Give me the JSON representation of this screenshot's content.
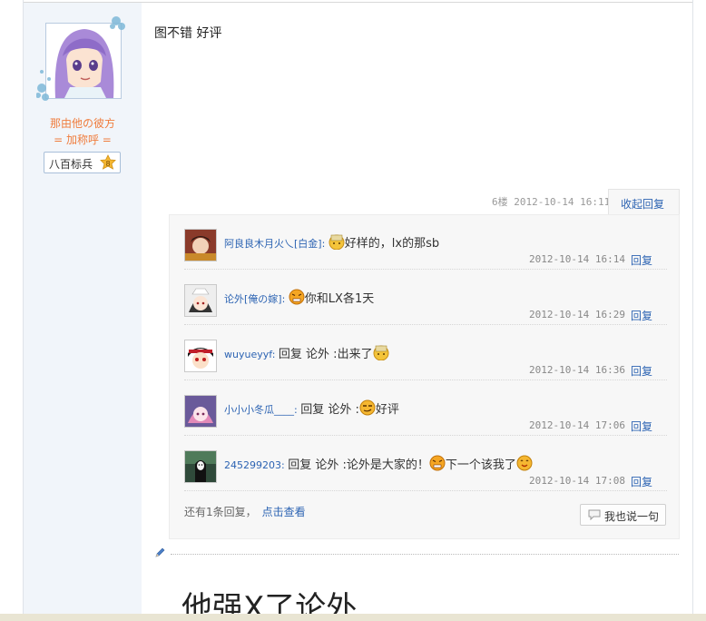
{
  "author": {
    "username": "那由他の彼方",
    "nickname": "= 加称呼 =",
    "rank_label": "八百标兵",
    "rank_level": "8"
  },
  "post": {
    "text": "图不错 好评",
    "floor_meta": "6楼 2012-10-14 16:11",
    "collapse_label": "收起回复"
  },
  "replies": [
    {
      "user": "阿良良木月火乀[白金]",
      "segments": [
        "",
        "好样的，lx的那sb"
      ],
      "emoticons": [
        "gold-face"
      ],
      "time": "2012-10-14 16:14",
      "reply_label": "回复"
    },
    {
      "user": "论外[俺の嫁]",
      "segments": [
        "",
        "你和LX各1天"
      ],
      "emoticons": [
        "angry-face"
      ],
      "time": "2012-10-14 16:29",
      "reply_label": "回复"
    },
    {
      "user": "wuyueyyf",
      "segments": [
        "回复 论外 :出来了"
      ],
      "emoticons": [
        "gold-face"
      ],
      "time": "2012-10-14 16:36",
      "reply_label": "回复"
    },
    {
      "user": "小小小冬瓜____",
      "segments": [
        "回复 论外 :",
        "好评"
      ],
      "emoticons": [
        "sly-face"
      ],
      "time": "2012-10-14 17:06",
      "reply_label": "回复"
    },
    {
      "user": "245299203",
      "segments": [
        "回复 论外 :论外是大家的！",
        "下一个该我了"
      ],
      "emoticons": [
        "angry-face",
        "smile-face"
      ],
      "time": "2012-10-14 17:08",
      "reply_label": "回复"
    }
  ],
  "more": {
    "text": "还有1条回复，",
    "link": "点击查看"
  },
  "say_button": "我也说一句",
  "next_post_text": "他强X了论外",
  "colors": {
    "link": "#2d64b3",
    "username_orange": "#f07c3c",
    "sidebar_bg": "#f1f5fa",
    "reply_box_bg": "#f7f7f7"
  }
}
